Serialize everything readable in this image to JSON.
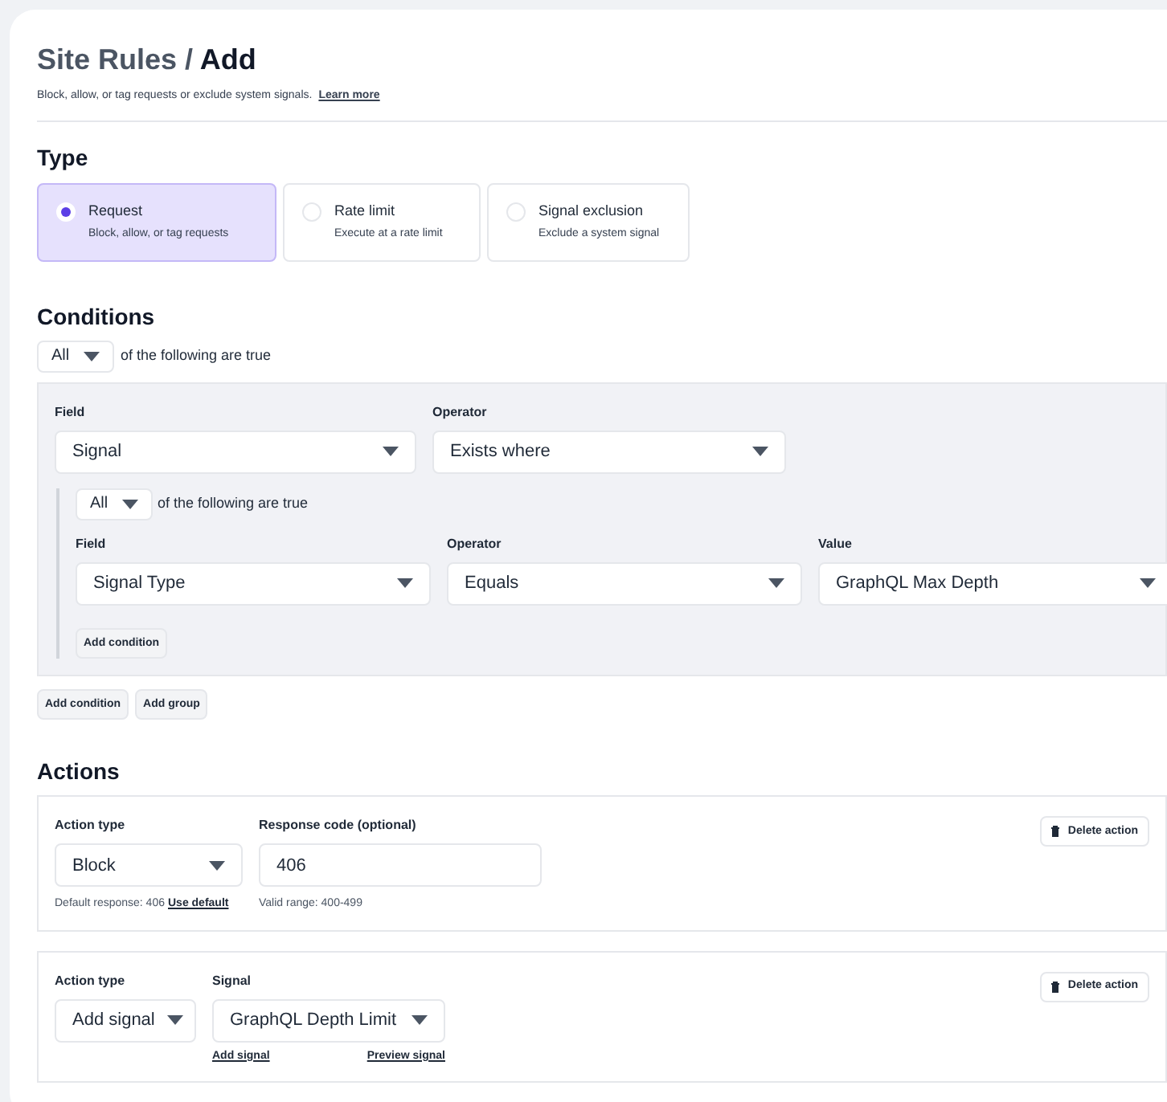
{
  "header": {
    "breadcrumb": "Site Rules /",
    "title": "Add",
    "description": "Block, allow, or tag requests or exclude system signals.",
    "link": "Learn more"
  },
  "type": {
    "heading": "Type",
    "options": [
      {
        "label": "Request",
        "description": "Block, allow, or tag requests",
        "selected": true
      },
      {
        "label": "Rate limit",
        "description": "Execute at a rate limit",
        "selected": false
      },
      {
        "label": "Signal exclusion",
        "description": "Exclude a system signal",
        "selected": false
      }
    ]
  },
  "conditions": {
    "heading": "Conditions",
    "match": "All",
    "match_text": "of the following are true",
    "group": {
      "fields": [
        {
          "label": "Field",
          "value": "Signal"
        },
        {
          "label": "Operator",
          "value": "Exists where"
        }
      ],
      "subgroup": {
        "match": "All",
        "match_text": "of the following are true",
        "fields": [
          {
            "label": "Field",
            "value": "Signal Type"
          },
          {
            "label": "Operator",
            "value": "Equals"
          },
          {
            "label": "Value",
            "value": "GraphQL Max Depth"
          }
        ],
        "add_button": "Add condition"
      }
    },
    "buttons": [
      "Add condition",
      "Add group"
    ]
  },
  "actions": {
    "heading": "Actions",
    "items": [
      {
        "kind": "block",
        "type_label": "Action type",
        "type_value": "Block",
        "field_label": "Response code (optional)",
        "field_value": "406",
        "hint": "Default response: 406",
        "hint_link": "Use default",
        "range": "Valid range: 400-499",
        "delete": "Delete action"
      },
      {
        "kind": "signal",
        "type_label": "Action type",
        "type_value": "Add signal",
        "field_label": "Signal",
        "field_value": "GraphQL Depth Limit",
        "links": [
          "Add signal",
          "Preview signal"
        ],
        "delete": "Delete action"
      }
    ]
  }
}
